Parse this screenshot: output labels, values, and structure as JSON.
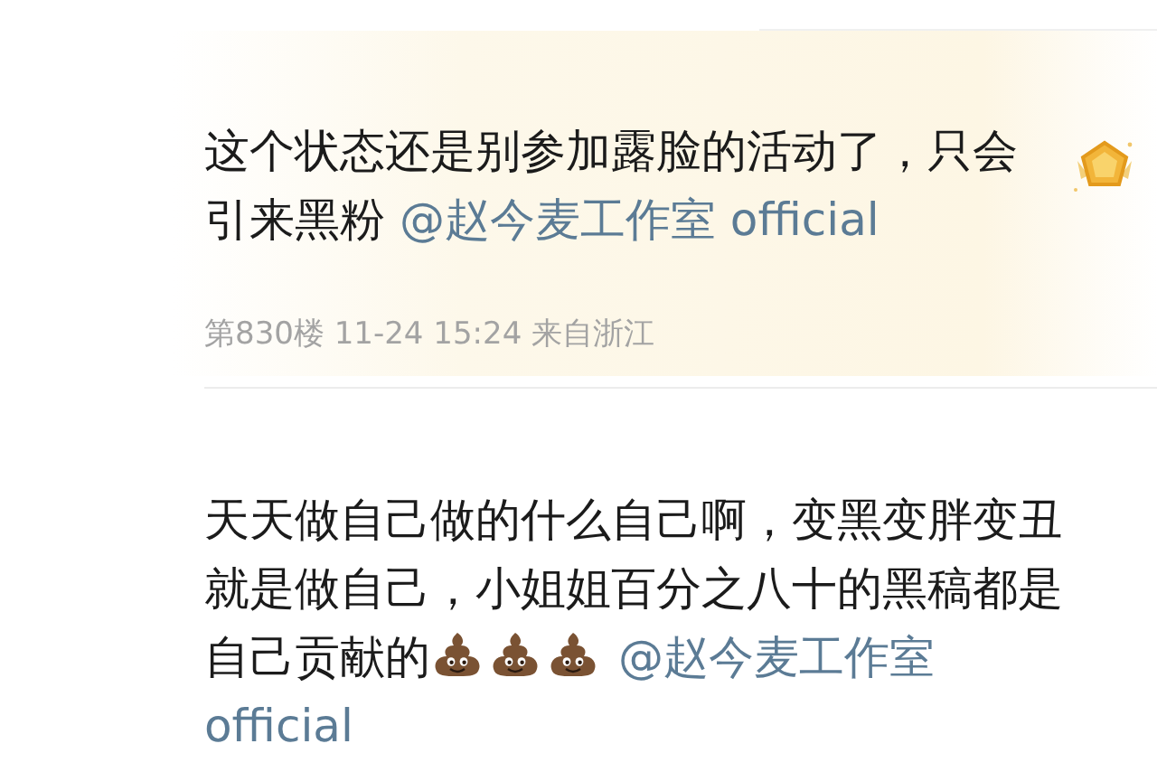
{
  "comments": [
    {
      "highlighted": true,
      "segments": [
        {
          "kind": "text",
          "text": "这个状态还是别参加露脸的活动了，只会引来黑粉"
        },
        {
          "kind": "mention",
          "text": "@赵今麦工作室 official"
        }
      ],
      "meta": "第830楼 11-24 15:24 来自浙江"
    },
    {
      "highlighted": false,
      "segments": [
        {
          "kind": "text",
          "text": "天天做自己做的什么自己啊，变黑变胖变丑就是做自己，小姐姐百分之八十的黑稿都是自己贡献的"
        },
        {
          "kind": "emoji"
        },
        {
          "kind": "emoji"
        },
        {
          "kind": "emoji"
        },
        {
          "kind": "mention",
          "text": "@赵今麦工作室 official"
        }
      ]
    }
  ]
}
